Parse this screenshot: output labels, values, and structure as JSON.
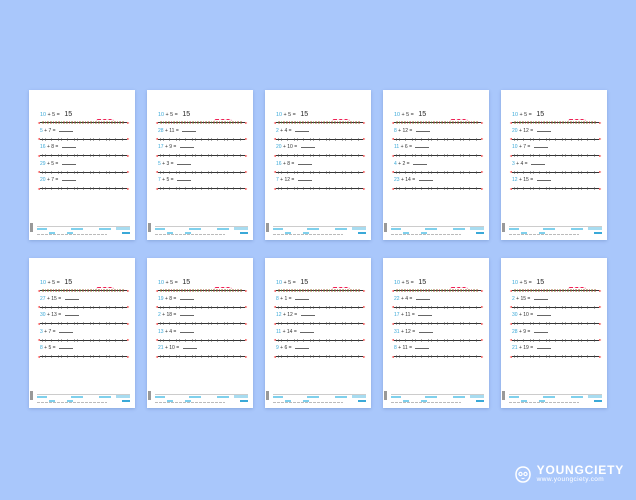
{
  "colors": {
    "background": "#a9c7fb",
    "sheet": "#ffffff",
    "accent_blue": "#3aa9d8",
    "arrow_red": "#e33333"
  },
  "sheets": [
    {
      "example": {
        "a": "10",
        "b": "5",
        "result": "15"
      },
      "problems": [
        {
          "a": "5",
          "b": "7"
        },
        {
          "a": "16",
          "b": "8"
        },
        {
          "a": "29",
          "b": "5"
        },
        {
          "a": "20",
          "b": "7"
        }
      ]
    },
    {
      "example": {
        "a": "10",
        "b": "5",
        "result": "15"
      },
      "problems": [
        {
          "a": "28",
          "b": "11"
        },
        {
          "a": "17",
          "b": "9"
        },
        {
          "a": "5",
          "b": "3"
        },
        {
          "a": "7",
          "b": "5"
        }
      ]
    },
    {
      "example": {
        "a": "10",
        "b": "5",
        "result": "15"
      },
      "problems": [
        {
          "a": "2",
          "b": "4"
        },
        {
          "a": "20",
          "b": "10"
        },
        {
          "a": "16",
          "b": "8"
        },
        {
          "a": "7",
          "b": "12"
        }
      ]
    },
    {
      "example": {
        "a": "10",
        "b": "5",
        "result": "15"
      },
      "problems": [
        {
          "a": "8",
          "b": "12"
        },
        {
          "a": "11",
          "b": "6"
        },
        {
          "a": "4",
          "b": "2"
        },
        {
          "a": "23",
          "b": "14"
        }
      ]
    },
    {
      "example": {
        "a": "10",
        "b": "5",
        "result": "15"
      },
      "problems": [
        {
          "a": "20",
          "b": "12"
        },
        {
          "a": "10",
          "b": "7"
        },
        {
          "a": "3",
          "b": "4"
        },
        {
          "a": "12",
          "b": "15"
        }
      ]
    },
    {
      "example": {
        "a": "10",
        "b": "5",
        "result": "15"
      },
      "problems": [
        {
          "a": "27",
          "b": "15"
        },
        {
          "a": "30",
          "b": "13"
        },
        {
          "a": "3",
          "b": "7"
        },
        {
          "a": "8",
          "b": "5"
        }
      ]
    },
    {
      "example": {
        "a": "10",
        "b": "5",
        "result": "15"
      },
      "problems": [
        {
          "a": "19",
          "b": "8"
        },
        {
          "a": "2",
          "b": "18"
        },
        {
          "a": "13",
          "b": "4"
        },
        {
          "a": "21",
          "b": "10"
        }
      ]
    },
    {
      "example": {
        "a": "10",
        "b": "5",
        "result": "15"
      },
      "problems": [
        {
          "a": "8",
          "b": "1"
        },
        {
          "a": "12",
          "b": "12"
        },
        {
          "a": "11",
          "b": "14"
        },
        {
          "a": "9",
          "b": "6"
        }
      ]
    },
    {
      "example": {
        "a": "10",
        "b": "5",
        "result": "15"
      },
      "problems": [
        {
          "a": "22",
          "b": "4"
        },
        {
          "a": "17",
          "b": "11"
        },
        {
          "a": "31",
          "b": "12"
        },
        {
          "a": "8",
          "b": "11"
        }
      ]
    },
    {
      "example": {
        "a": "10",
        "b": "5",
        "result": "15"
      },
      "problems": [
        {
          "a": "2",
          "b": "15"
        },
        {
          "a": "30",
          "b": "10"
        },
        {
          "a": "28",
          "b": "9"
        },
        {
          "a": "21",
          "b": "19"
        }
      ]
    }
  ],
  "brand": {
    "name": "YOUNGCIETY",
    "url": "www.youngciety.com",
    "icon": "owl-logo-icon"
  }
}
